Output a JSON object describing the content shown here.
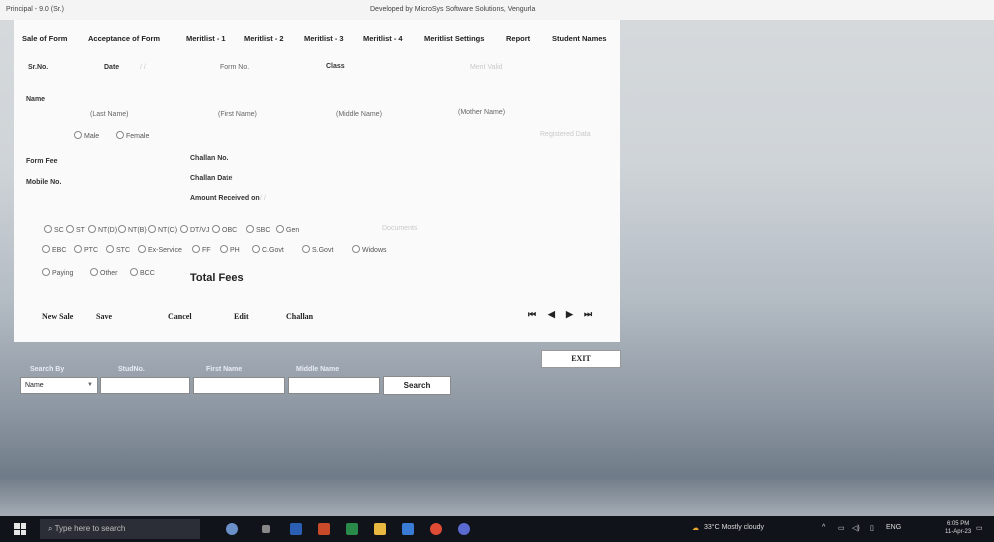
{
  "window": {
    "title": "Principal - 9.0 (Sr.)",
    "developer": "Developed by MicroSys Software Solutions, Vengurla"
  },
  "tabs": [
    "Sale of Form",
    "Acceptance of Form",
    "Meritlist - 1",
    "Meritlist - 2",
    "Meritlist - 3",
    "Meritlist - 4",
    "Meritlist Settings",
    "Report",
    "Student Names"
  ],
  "form": {
    "srno_label": "Sr.No.",
    "date_label": "Date",
    "date_value": "/ /",
    "form_no_label": "Form No.",
    "class_label": "Class",
    "class_hint": "Merit Valid",
    "name_label": "Name",
    "last_name": "(Last Name)",
    "first_name": "(First Name)",
    "middle_name": "(Middle Name)",
    "mother_name": "(Mother Name)",
    "male": "Male",
    "female": "Female",
    "gender_hint": "Registered Data",
    "form_fee_label": "Form Fee",
    "mobile_label": "Mobile No.",
    "challan_no_label": "Challan No.",
    "challan_date_label": "Challan Date",
    "challan_date_value": "/ /",
    "amount_received_label": "Amount Received on",
    "amount_received_value": "/ /",
    "category_row1": [
      "SC",
      "ST",
      "NT(D)",
      "NT(B)",
      "NT(C)",
      "DT/VJ",
      "OBC",
      "SBC",
      "Gen"
    ],
    "category_hint": "Documents",
    "category_row2": [
      "EBC",
      "PTC",
      "STC",
      "Ex-Service",
      "FF",
      "PH",
      "C.Govt",
      "S.Govt",
      "Widows"
    ],
    "category_row3": [
      "Paying",
      "Other",
      "BCC"
    ],
    "total_fees": "Total Fees"
  },
  "buttons": {
    "new_sale": "New Sale",
    "save": "Save",
    "cancel": "Cancel",
    "edit": "Edit",
    "challan": "Challan",
    "nav_first": "⏮",
    "nav_prev": "◀",
    "nav_next": "▶",
    "nav_last": "⏭",
    "exit": "EXIT"
  },
  "search": {
    "search_by_label": "Search By",
    "student_no_label": "StudNo.",
    "first_name_label": "First Name",
    "middle_name_label": "Middle Name",
    "search_by_value": "Name",
    "button": "Search"
  },
  "taskbar": {
    "search_placeholder": "Type here to search",
    "weather": "33°C  Mostly cloudy",
    "lang": "ENG",
    "time": "6:05 PM",
    "date": "11-Apr-23"
  }
}
